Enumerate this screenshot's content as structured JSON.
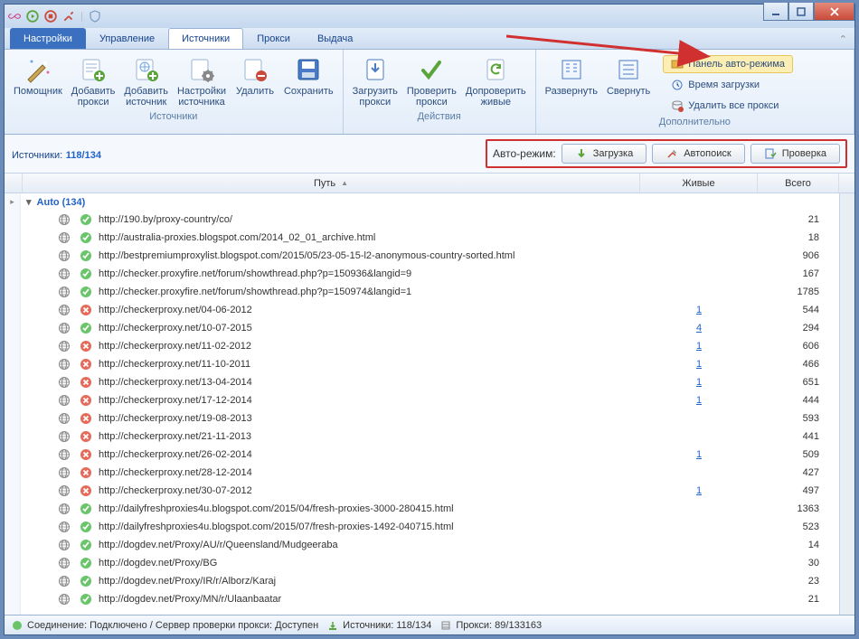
{
  "tabs": {
    "settings": "Настройки",
    "manage": "Управление",
    "sources": "Источники",
    "proxy": "Прокси",
    "output": "Выдача"
  },
  "ribbon": {
    "sources": {
      "title": "Источники",
      "wizard": "Помощник",
      "add_proxy": "Добавить\nпрокси",
      "add_source": "Добавить\nисточник",
      "src_settings": "Настройки\nисточника",
      "delete": "Удалить",
      "save": "Сохранить"
    },
    "actions": {
      "title": "Действия",
      "load": "Загрузить\nпрокси",
      "check": "Проверить\nпрокси",
      "recheck": "Допроверить\nживые"
    },
    "extra": {
      "title": "Дополнительно",
      "expand": "Развернуть",
      "collapse": "Свернуть",
      "panel": "Панель авто-режима",
      "load_time": "Время загрузки",
      "delete_all": "Удалить все прокси"
    }
  },
  "panel": {
    "left_label": "Источники:",
    "left_count": "118/134",
    "auto_label": "Авто-режим:",
    "btn_load": "Загрузка",
    "btn_autosrch": "Автопоиск",
    "btn_check": "Проверка"
  },
  "grid": {
    "col_path": "Путь",
    "col_live": "Живые",
    "col_total": "Всего",
    "group": "Auto (134)"
  },
  "rows": [
    {
      "ok": true,
      "url": "http://190.by/proxy-country/co/",
      "live": "",
      "total": "21"
    },
    {
      "ok": true,
      "url": "http://australia-proxies.blogspot.com/2014_02_01_archive.html",
      "live": "",
      "total": "18"
    },
    {
      "ok": true,
      "url": "http://bestpremiumproxylist.blogspot.com/2015/05/23-05-15-l2-anonymous-country-sorted.html",
      "live": "",
      "total": "906"
    },
    {
      "ok": true,
      "url": "http://checker.proxyfire.net/forum/showthread.php?p=150936&amp;langid=9",
      "live": "",
      "total": "167"
    },
    {
      "ok": true,
      "url": "http://checker.proxyfire.net/forum/showthread.php?p=150974&amp;langid=1",
      "live": "",
      "total": "1785"
    },
    {
      "ok": false,
      "url": "http://checkerproxy.net/04-06-2012",
      "live": "1",
      "total": "544"
    },
    {
      "ok": true,
      "url": "http://checkerproxy.net/10-07-2015",
      "live": "4",
      "total": "294"
    },
    {
      "ok": false,
      "url": "http://checkerproxy.net/11-02-2012",
      "live": "1",
      "total": "606"
    },
    {
      "ok": false,
      "url": "http://checkerproxy.net/11-10-2011",
      "live": "1",
      "total": "466"
    },
    {
      "ok": false,
      "url": "http://checkerproxy.net/13-04-2014",
      "live": "1",
      "total": "651"
    },
    {
      "ok": false,
      "url": "http://checkerproxy.net/17-12-2014",
      "live": "1",
      "total": "444"
    },
    {
      "ok": false,
      "url": "http://checkerproxy.net/19-08-2013",
      "live": "",
      "total": "593"
    },
    {
      "ok": false,
      "url": "http://checkerproxy.net/21-11-2013",
      "live": "",
      "total": "441"
    },
    {
      "ok": false,
      "url": "http://checkerproxy.net/26-02-2014",
      "live": "1",
      "total": "509"
    },
    {
      "ok": false,
      "url": "http://checkerproxy.net/28-12-2014",
      "live": "",
      "total": "427"
    },
    {
      "ok": false,
      "url": "http://checkerproxy.net/30-07-2012",
      "live": "1",
      "total": "497"
    },
    {
      "ok": true,
      "url": "http://dailyfreshproxies4u.blogspot.com/2015/04/fresh-proxies-3000-280415.html",
      "live": "",
      "total": "1363"
    },
    {
      "ok": true,
      "url": "http://dailyfreshproxies4u.blogspot.com/2015/07/fresh-proxies-1492-040715.html",
      "live": "",
      "total": "523"
    },
    {
      "ok": true,
      "url": "http://dogdev.net/Proxy/AU/r/Queensland/Mudgeeraba",
      "live": "",
      "total": "14"
    },
    {
      "ok": true,
      "url": "http://dogdev.net/Proxy/BG",
      "live": "",
      "total": "30"
    },
    {
      "ok": true,
      "url": "http://dogdev.net/Proxy/IR/r/Alborz/Karaj",
      "live": "",
      "total": "23"
    },
    {
      "ok": true,
      "url": "http://dogdev.net/Proxy/MN/r/Ulaanbaatar",
      "live": "",
      "total": "21"
    }
  ],
  "status": {
    "conn": "Соединение: Подключено / Сервер проверки прокси: Доступен",
    "sources": "Источники: 118/134",
    "proxy": "Прокси: 89/133163"
  }
}
